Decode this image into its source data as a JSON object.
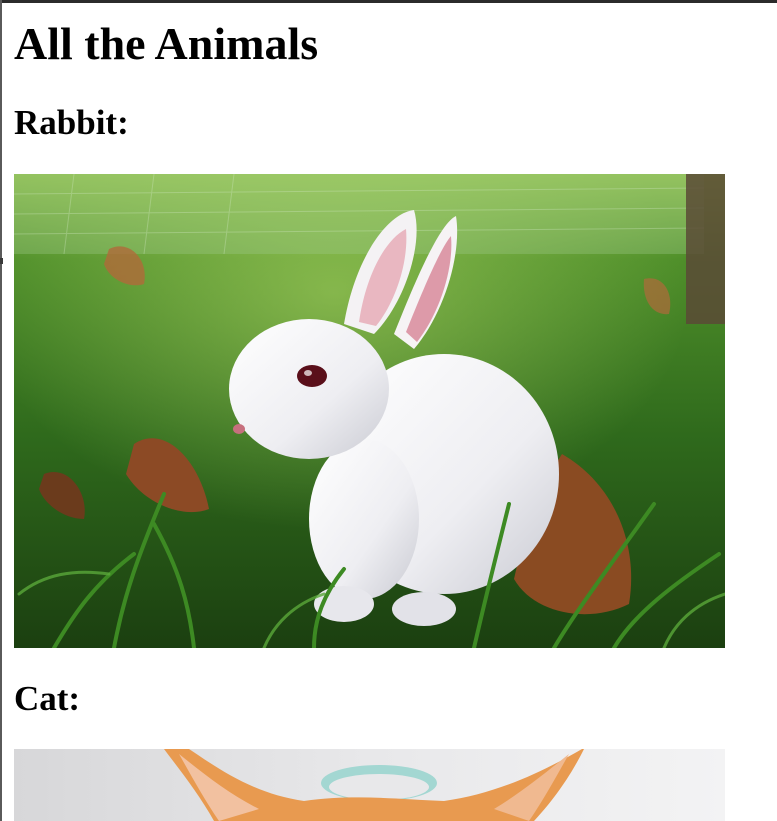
{
  "page": {
    "title": "All the Animals"
  },
  "animals": [
    {
      "label": "Rabbit:",
      "photo_subject": "white rabbit sitting in grass with fallen leaves"
    },
    {
      "label": "Cat:",
      "photo_subject": "orange cat ears"
    }
  ],
  "colors": {
    "text": "#000000",
    "background": "#ffffff",
    "grass": "#2f6a1c",
    "rabbit_fur": "#f2f2f4",
    "cat_fur": "#e89a50"
  }
}
